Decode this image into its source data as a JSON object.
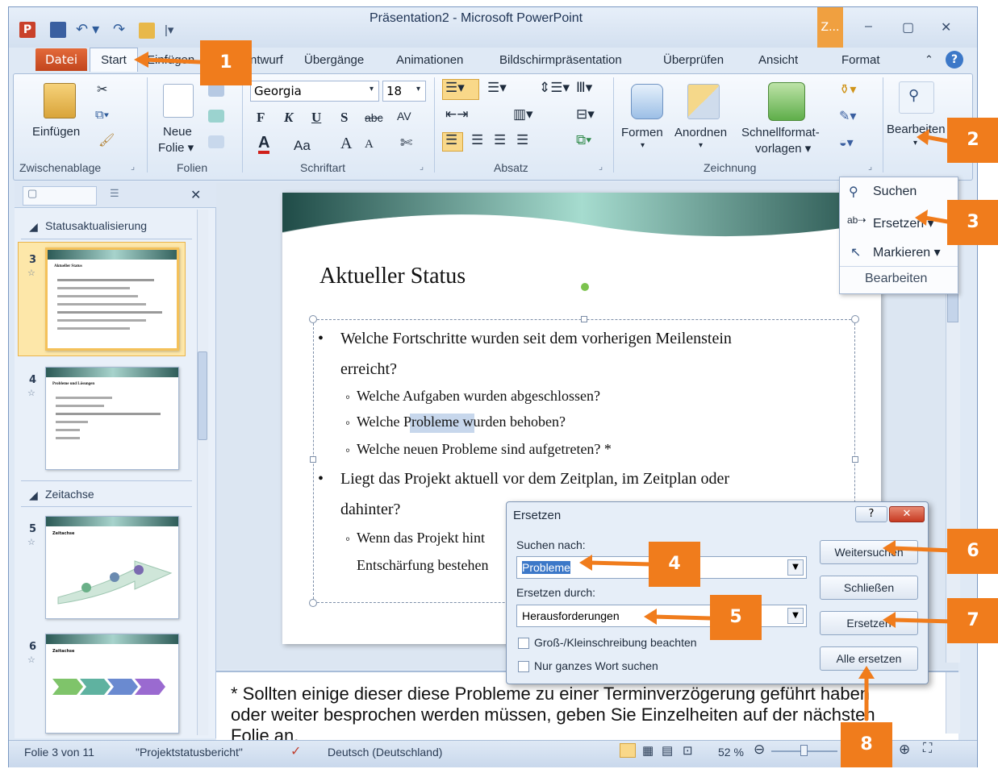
{
  "window": {
    "title": "Präsentation2 - Microsoft PowerPoint",
    "context_tab": "Z...",
    "minimize": "–",
    "maximize": "▢",
    "close": "✕"
  },
  "tabs": [
    {
      "label": "Datei"
    },
    {
      "label": "Start"
    },
    {
      "label": "Einfügen"
    },
    {
      "label": "Entwurf"
    },
    {
      "label": "Übergänge"
    },
    {
      "label": "Animationen"
    },
    {
      "label": "Bildschirmpräsentation"
    },
    {
      "label": "Überprüfen"
    },
    {
      "label": "Ansicht"
    },
    {
      "label": "Format"
    }
  ],
  "ribbon": {
    "clipboard": {
      "paste_label": "Einfügen",
      "group_label": "Zwischenablage"
    },
    "slides": {
      "new_slide_line1": "Neue",
      "new_slide_line2": "Folie ▾",
      "group_label": "Folien"
    },
    "font": {
      "font_name": "Georgia",
      "font_size": "18",
      "bold": "F",
      "italic": "K",
      "underline": "U",
      "shadow": "S",
      "strike": "abc",
      "spacing": "AV",
      "color": "A",
      "case": "Aa",
      "grow": "A",
      "shrink": "A",
      "clear": "✄",
      "group_label": "Schriftart"
    },
    "paragraph": {
      "group_label": "Absatz"
    },
    "drawing": {
      "shapes_label": "Formen",
      "arrange_label": "Anordnen",
      "quickstyles_line1": "Schnellformat-",
      "quickstyles_line2": "vorlagen ▾",
      "group_label": "Zeichnung"
    },
    "editing": {
      "label": "Bearbeiten"
    }
  },
  "dropdown": {
    "items": [
      {
        "label": "Suchen"
      },
      {
        "label": "Ersetzen ▾"
      },
      {
        "label": "Markieren ▾"
      }
    ],
    "footer": "Bearbeiten"
  },
  "panel": {
    "sections": [
      {
        "label": "Statusaktualisierung"
      },
      {
        "label": "Zeitachse"
      }
    ],
    "slides": [
      {
        "number": "3",
        "title": "Aktueller Status"
      },
      {
        "number": "4",
        "title": "Probleme und Lösungen"
      },
      {
        "number": "5",
        "title": "Zeitachse"
      },
      {
        "number": "6",
        "title": "Zeitachse"
      }
    ]
  },
  "slide": {
    "title": "Aktueller Status",
    "bullets": [
      {
        "text": "Welche Fortschritte wurden seit dem vorherigen Meilenstein",
        "level": 1
      },
      {
        "text": "erreicht?",
        "level": 0
      },
      {
        "text": "Welche Aufgaben wurden abgeschlossen?",
        "level": 2
      },
      {
        "text": "Welche Probleme wurden behoben?",
        "level": 2
      },
      {
        "text": "Welche neuen Probleme sind aufgetreten? *",
        "level": 2
      },
      {
        "text": "Liegt das Projekt aktuell vor dem Zeitplan, im Zeitplan oder",
        "level": 1
      },
      {
        "text": "dahinter?",
        "level": 0
      },
      {
        "text": "Wenn das Projekt hint",
        "level": 2
      },
      {
        "text": "Entschärfung bestehen",
        "level": 0
      }
    ]
  },
  "notes": {
    "line1": "* Sollten einige dieser diese Probleme zu einer Terminverzögerung geführt haben",
    "line2": "oder weiter besprochen werden müssen, geben Sie Einzelheiten auf der nächsten",
    "line3": "Folie an."
  },
  "dialog": {
    "title": "Ersetzen",
    "find_label": "Suchen nach:",
    "find_value": "Probleme",
    "replace_label": "Ersetzen durch:",
    "replace_value": "Herausforderungen",
    "match_case": "Groß-/Kleinschreibung beachten",
    "whole_word": "Nur ganzes Wort suchen",
    "btn_next": "Weitersuchen",
    "btn_close": "Schließen",
    "btn_replace": "Ersetzen",
    "btn_replace_all": "Alle ersetzen",
    "help": "?",
    "close": "✕"
  },
  "statusbar": {
    "slide_info": "Folie 3 von 11",
    "theme": "\"Projektstatusbericht\"",
    "language": "Deutsch (Deutschland)",
    "zoom": "52 %"
  },
  "callouts": [
    "1",
    "2",
    "3",
    "4",
    "5",
    "6",
    "7",
    "8"
  ],
  "colors": {
    "callout": "#f07c1c",
    "datei_tab": "#d0582a",
    "selection": "#f4c15a"
  }
}
